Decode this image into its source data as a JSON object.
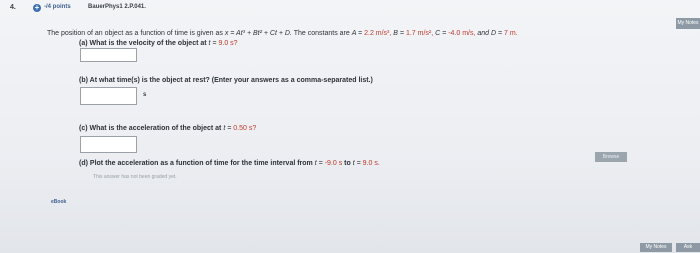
{
  "header": {
    "question_number": "4.",
    "points_label": "-/4 points",
    "question_id": "BauerPhys1 2.P.041.",
    "my_notes_top": "My Notes"
  },
  "question": {
    "intro_prefix": "The position of an object as a function of time is given as",
    "equation": "x = At³ + Bt² + Ct + D.",
    "constants_prefix": "The constants are",
    "A_label": "A =",
    "A_value": "2.2 m/s³,",
    "B_label": "B =",
    "B_value": "1.7 m/s²,",
    "C_label": "C =",
    "C_value": "-4.0 m/s,",
    "D_label": "and D =",
    "D_value": "7 m."
  },
  "parts": {
    "a_label": "(a)",
    "a_text": "What is the velocity of the object at",
    "a_var": "t =",
    "a_value": "9.0 s?",
    "b_label": "(b)",
    "b_text": "At what time(s) is the object at rest? (Enter your answers as a comma-separated list.)",
    "b_unit": "s",
    "c_label": "(c)",
    "c_text": "What is the acceleration of the object at",
    "c_var": "t =",
    "c_value": "0.50 s?",
    "d_label": "(d)",
    "d_text": "Plot the acceleration as a function of time for the time interval from",
    "d_from_var": "t =",
    "d_from": "-9.0 s",
    "d_to_text": "to",
    "d_to_var": "t =",
    "d_to": "9.0 s.",
    "browse_label": "Browse",
    "not_graded": "This answer has not been graded yet."
  },
  "footer": {
    "ebook": "eBook",
    "my_notes": "My Notes",
    "ask": "Ask"
  },
  "colors": {
    "accent_red": "#c0392b",
    "link_blue": "#3f5f92",
    "button_gray": "#8d9aa5"
  }
}
